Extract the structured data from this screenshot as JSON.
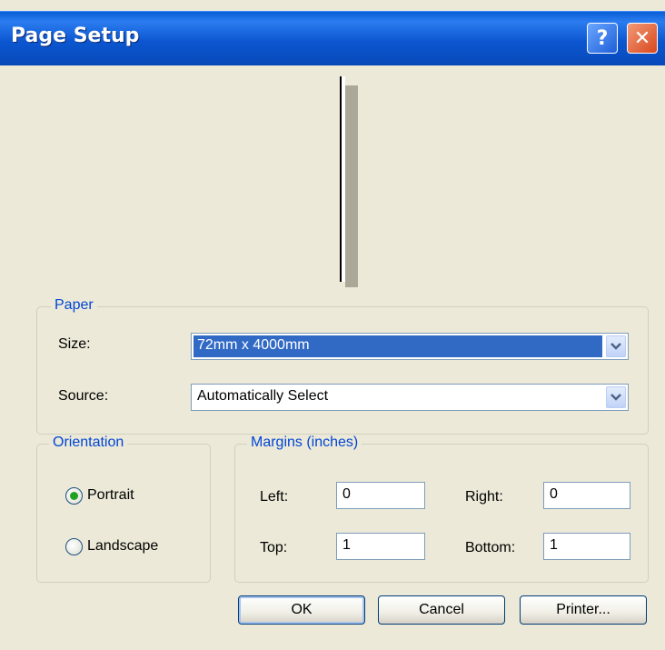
{
  "window": {
    "title": "Page Setup",
    "help_glyph": "?",
    "close_glyph": "✕"
  },
  "paper": {
    "legend": "Paper",
    "size_label": "Size:",
    "size_value": "72mm x 4000mm",
    "source_label": "Source:",
    "source_value": "Automatically Select"
  },
  "orientation": {
    "legend": "Orientation",
    "portrait_label": "Portrait",
    "landscape_label": "Landscape",
    "selected": "Portrait"
  },
  "margins": {
    "legend": "Margins (inches)",
    "left_label": "Left:",
    "left_value": "0",
    "right_label": "Right:",
    "right_value": "0",
    "top_label": "Top:",
    "top_value": "1",
    "bottom_label": "Bottom:",
    "bottom_value": "1"
  },
  "buttons": {
    "ok": "OK",
    "cancel": "Cancel",
    "printer": "Printer..."
  },
  "colors": {
    "titlebar": "#0a5fd6",
    "legend_text": "#0046d5",
    "selection": "#316ac5",
    "dialog_bg": "#ece9d8"
  }
}
